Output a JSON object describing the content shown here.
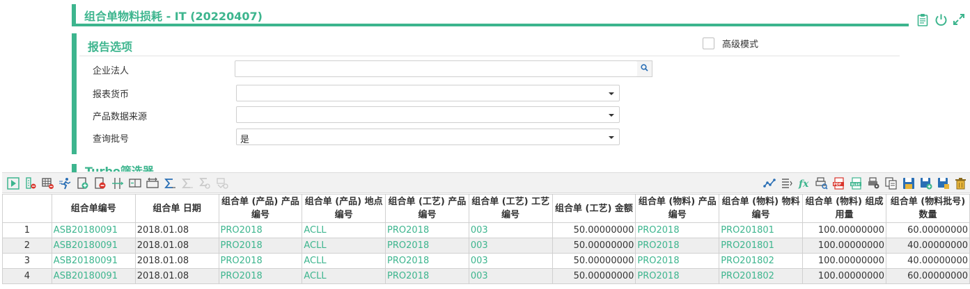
{
  "header": {
    "title": "组合单物料损耗 - IT (20220407)"
  },
  "top_icons": [
    "clipboard-icon",
    "power-icon",
    "expand-icon"
  ],
  "report_options": {
    "title": "报告选项",
    "advanced_mode_label": "高级模式",
    "advanced_mode_checked": false,
    "fields": {
      "legal_entity": {
        "label": "企业法人",
        "value": ""
      },
      "report_currency": {
        "label": "报表货币",
        "value": ""
      },
      "product_data_source": {
        "label": "产品数据来源",
        "value": ""
      },
      "query_batch": {
        "label": "查询批号",
        "value": "是"
      }
    }
  },
  "turbo": {
    "title": "Turbo筛选器"
  },
  "colors": {
    "accent": "#3db58e",
    "red": "#d9342b",
    "blue": "#2a6fb5"
  },
  "toolbar": {
    "left": [
      "play-icon",
      "column-remove-icon",
      "grid-remove-icon",
      "run-icon",
      "add-row-icon",
      "remove-row-icon",
      "column-split-icon",
      "column-merge-icon",
      "range-icon",
      "sum-icon",
      "sum-disabled-icon",
      "sum-view-icon",
      "filter-view-icon"
    ],
    "right": [
      "chart-icon",
      "list-icon",
      "formula-icon",
      "print-preview-icon",
      "pdf-icon",
      "excel-icon",
      "print-settings-icon",
      "copy-icon",
      "save-icon",
      "save-add-icon",
      "save-edit-icon",
      "delete-icon"
    ]
  },
  "table": {
    "headers": [
      "",
      "组合单编号",
      "组合单 日期",
      "组合单 (产品) 产品编号",
      "组合单 (产品) 地点编号",
      "组合单 (工艺) 产品编号",
      "组合单 (工艺) 工艺编号",
      "组合单 (工艺) 金额",
      "组合单 (物料) 产品编号",
      "组合单 (物料) 物料编号",
      "组合单 (物料) 组成用量",
      "组合单 (物料批号) 数量"
    ],
    "rows": [
      [
        "1",
        "ASB20180091",
        "2018.01.08",
        "PRO2018",
        "ACLL",
        "PRO2018",
        "003",
        "50.00000000",
        "PRO2018",
        "PRO201801",
        "100.00000000",
        "60.00000000"
      ],
      [
        "2",
        "ASB20180091",
        "2018.01.08",
        "PRO2018",
        "ACLL",
        "PRO2018",
        "003",
        "50.00000000",
        "PRO2018",
        "PRO201801",
        "100.00000000",
        "40.00000000"
      ],
      [
        "3",
        "ASB20180091",
        "2018.01.08",
        "PRO2018",
        "ACLL",
        "PRO2018",
        "003",
        "50.00000000",
        "PRO2018",
        "PRO201802",
        "100.00000000",
        "40.00000000"
      ],
      [
        "4",
        "ASB20180091",
        "2018.01.08",
        "PRO2018",
        "ACLL",
        "PRO2018",
        "003",
        "50.00000000",
        "PRO2018",
        "PRO201802",
        "100.00000000",
        "60.00000000"
      ]
    ]
  }
}
